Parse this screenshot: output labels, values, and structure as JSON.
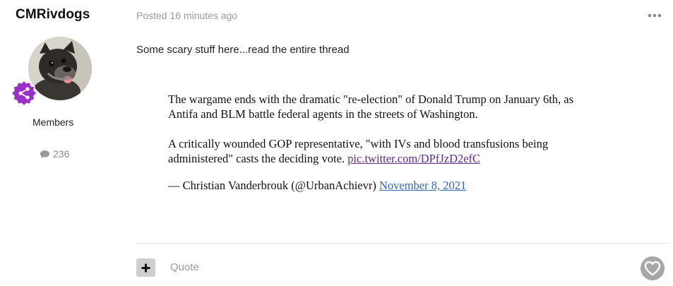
{
  "author": {
    "username": "CMRivdogs",
    "role": "Members",
    "post_count": "236",
    "badge_color": "#9b30c8"
  },
  "post": {
    "meta": "Posted 16 minutes ago",
    "text": "Some scary stuff here...read the entire thread"
  },
  "tweet": {
    "paragraph1": "The wargame ends with the dramatic \"re-election\" of Donald Trump on January 6th, as Antifa and BLM battle federal agents in the streets of Washington.",
    "paragraph2_text": "A critically wounded GOP representative, \"with IVs and blood transfusions being administered\" casts the deciding vote. ",
    "paragraph2_link": "pic.twitter.com/DPfJzD2efC",
    "attribution": "— Christian Vanderbrouk (@UrbanAchievr) ",
    "date_link": "November 8, 2021",
    "link_color_visited": "#5e2a84",
    "link_color": "#3467b3"
  },
  "actions": {
    "quote_label": "Quote",
    "plus_icon": "plus-icon",
    "heart_icon": "heart-icon",
    "more_icon": "ellipsis-icon"
  }
}
